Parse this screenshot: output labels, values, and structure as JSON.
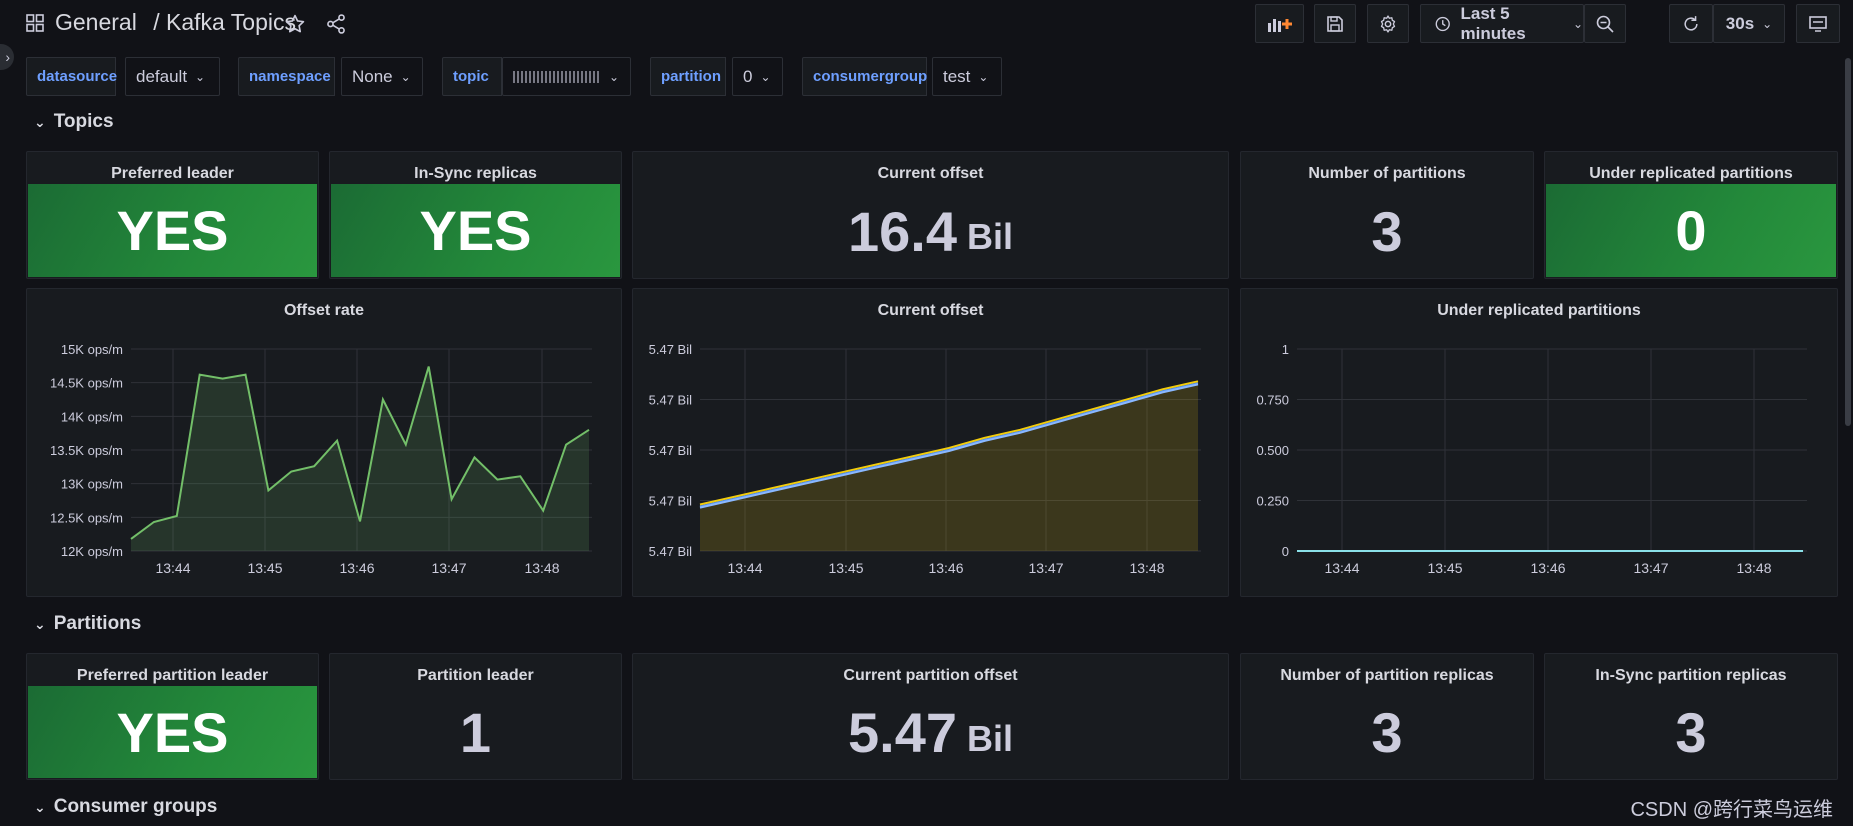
{
  "header": {
    "breadcrumb_folder": "General",
    "breadcrumb_separator": "/",
    "dashboard_title": "Kafka Topics",
    "time_range": "Last 5 minutes",
    "refresh_interval": "30s"
  },
  "variables": [
    {
      "label": "datasource",
      "value": "default"
    },
    {
      "label": "namespace",
      "value": "None"
    },
    {
      "label": "topic",
      "value": ""
    },
    {
      "label": "partition",
      "value": "0"
    },
    {
      "label": "consumergroup",
      "value": "test"
    }
  ],
  "rows": {
    "topics": "Topics",
    "partitions": "Partitions",
    "consumer_groups": "Consumer groups"
  },
  "topics_stats": {
    "preferred_leader": {
      "title": "Preferred leader",
      "value": "YES"
    },
    "in_sync_replicas": {
      "title": "In-Sync replicas",
      "value": "YES"
    },
    "current_offset": {
      "title": "Current offset",
      "value": "16.4",
      "unit": "Bil"
    },
    "number_of_partitions": {
      "title": "Number of partitions",
      "value": "3"
    },
    "under_replicated": {
      "title": "Under replicated partitions",
      "value": "0"
    }
  },
  "partition_stats": {
    "preferred_partition_leader": {
      "title": "Preferred partition leader",
      "value": "YES"
    },
    "partition_leader": {
      "title": "Partition leader",
      "value": "1"
    },
    "current_partition_offset": {
      "title": "Current partition offset",
      "value": "5.47",
      "unit": "Bil"
    },
    "number_of_partition_replicas": {
      "title": "Number of partition replicas",
      "value": "3"
    },
    "in_sync_partition_replicas": {
      "title": "In-Sync partition replicas",
      "value": "3"
    }
  },
  "colors": {
    "green_stat": "#23893a",
    "offset_rate_line": "#73bf69",
    "offset_line_a": "#f2cc0c",
    "offset_line_b": "#5794f2",
    "offset_line_c": "#73bf69",
    "offset_line_d": "#8ab8ff",
    "under_replicated_line": "#8ae0e8",
    "variable_label": "#6e9fff"
  },
  "watermark": "CSDN @跨行菜鸟运维",
  "chart_data": [
    {
      "type": "area",
      "title": "Offset rate",
      "x": [
        "13:43:40",
        "13:43:50",
        "13:44:00",
        "13:44:10",
        "13:44:20",
        "13:44:30",
        "13:44:40",
        "13:44:50",
        "13:45:00",
        "13:45:10",
        "13:45:20",
        "13:45:30",
        "13:45:40",
        "13:45:50",
        "13:46:00",
        "13:46:10",
        "13:46:20",
        "13:46:30",
        "13:46:40",
        "13:46:50",
        "13:47:00",
        "13:47:10",
        "13:47:20",
        "13:47:30",
        "13:47:40",
        "13:47:50",
        "13:48:00",
        "13:48:10"
      ],
      "x_ticks": [
        "13:44",
        "13:45",
        "13:46",
        "13:47",
        "13:48"
      ],
      "y_ticks": [
        "12K ops/m",
        "12.5K ops/m",
        "13K ops/m",
        "13.5K ops/m",
        "14K ops/m",
        "14.5K ops/m",
        "15K ops/m"
      ],
      "series": [
        {
          "values": [
            12180,
            12430,
            12520,
            14620,
            14560,
            14620,
            12900,
            13180,
            13260,
            13640,
            12440,
            14250,
            13580,
            14740,
            12770,
            13390,
            13060,
            13110,
            12600,
            13580,
            13800
          ]
        }
      ],
      "ylim": [
        12000,
        15000
      ]
    },
    {
      "type": "area",
      "title": "Current offset",
      "x_ticks": [
        "13:44",
        "13:45",
        "13:46",
        "13:47",
        "13:48"
      ],
      "y_ticks": [
        "5.47 Bil",
        "5.47 Bil",
        "5.47 Bil",
        "5.47 Bil",
        "5.47 Bil"
      ],
      "series": [
        {
          "values": [
            0.23,
            0.27,
            0.31,
            0.35,
            0.39,
            0.43,
            0.47,
            0.51,
            0.56,
            0.6,
            0.65,
            0.7,
            0.75,
            0.8,
            0.84
          ]
        },
        {
          "values": [
            0.22,
            0.26,
            0.3,
            0.34,
            0.38,
            0.42,
            0.46,
            0.5,
            0.55,
            0.59,
            0.64,
            0.69,
            0.74,
            0.79,
            0.83
          ]
        },
        {
          "values": [
            0.215,
            0.255,
            0.295,
            0.335,
            0.375,
            0.415,
            0.455,
            0.495,
            0.545,
            0.585,
            0.635,
            0.685,
            0.735,
            0.785,
            0.825
          ]
        }
      ],
      "ylim": [
        0,
        1
      ]
    },
    {
      "type": "line",
      "title": "Under replicated partitions",
      "x_ticks": [
        "13:44",
        "13:45",
        "13:46",
        "13:47",
        "13:48"
      ],
      "y_ticks": [
        "0",
        "0.250",
        "0.500",
        "0.750",
        "1"
      ],
      "series": [
        {
          "values": [
            0,
            0,
            0,
            0,
            0,
            0,
            0,
            0,
            0,
            0
          ]
        }
      ],
      "ylim": [
        0,
        1
      ]
    }
  ]
}
